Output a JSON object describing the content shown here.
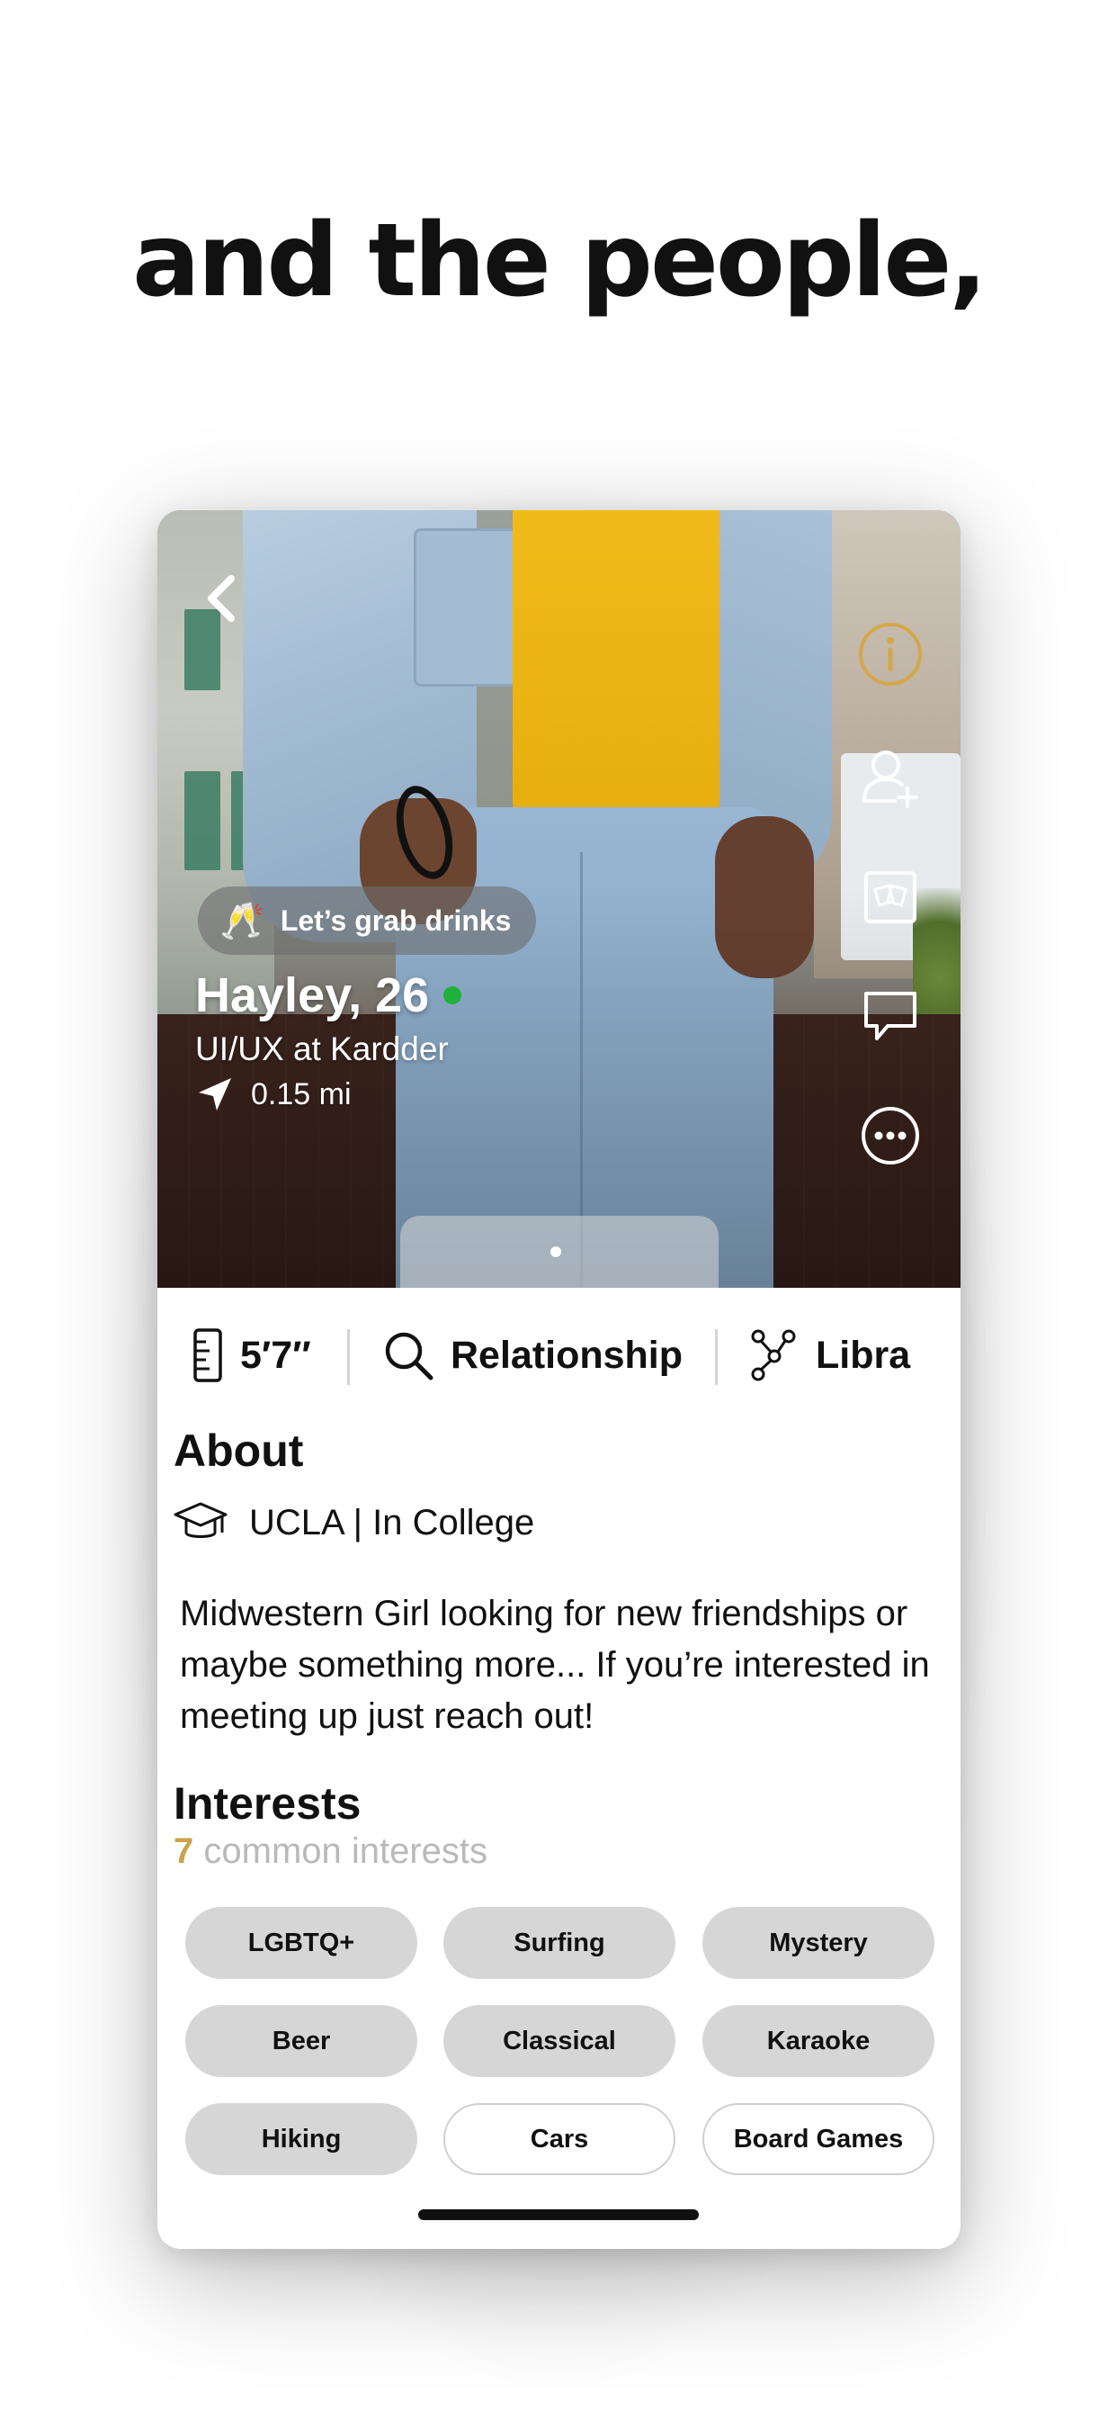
{
  "headline": "and the people,",
  "profile": {
    "promo": {
      "emoji": "🥂",
      "text": "Let’s grab drinks"
    },
    "name_age": "Hayley, 26",
    "job": "UI/UX at Kardder",
    "distance": "0.15 mi",
    "online": true,
    "photo_pages": 1,
    "current_page": 1
  },
  "side_actions": {
    "info_icon": "info-icon",
    "add_friend_icon": "add-user-icon",
    "drinks_icon": "cheers-glass-icon",
    "message_icon": "chat-bubble-icon",
    "more_icon": "more-options-icon"
  },
  "stats": {
    "height": "5′7″",
    "looking_for": "Relationship",
    "zodiac": "Libra"
  },
  "about": {
    "title": "About",
    "school": "UCLA | In College",
    "bio": "Midwestern Girl looking for new friendships or maybe something more... If you’re interested in meeting up just reach out!"
  },
  "interests": {
    "title": "Interests",
    "common_count": "7",
    "common_label": "common interests",
    "items": [
      {
        "label": "LGBTQ+",
        "common": true
      },
      {
        "label": "Surfing",
        "common": true
      },
      {
        "label": "Mystery",
        "common": true
      },
      {
        "label": "Beer",
        "common": true
      },
      {
        "label": "Classical",
        "common": true
      },
      {
        "label": "Karaoke",
        "common": true
      },
      {
        "label": "Hiking",
        "common": true
      },
      {
        "label": "Cars",
        "common": false
      },
      {
        "label": "Board Games",
        "common": false
      }
    ]
  },
  "colors": {
    "accent_gold": "#c9a24a",
    "online_green": "#1fb23a",
    "chip_filled": "#d6d6d6"
  }
}
